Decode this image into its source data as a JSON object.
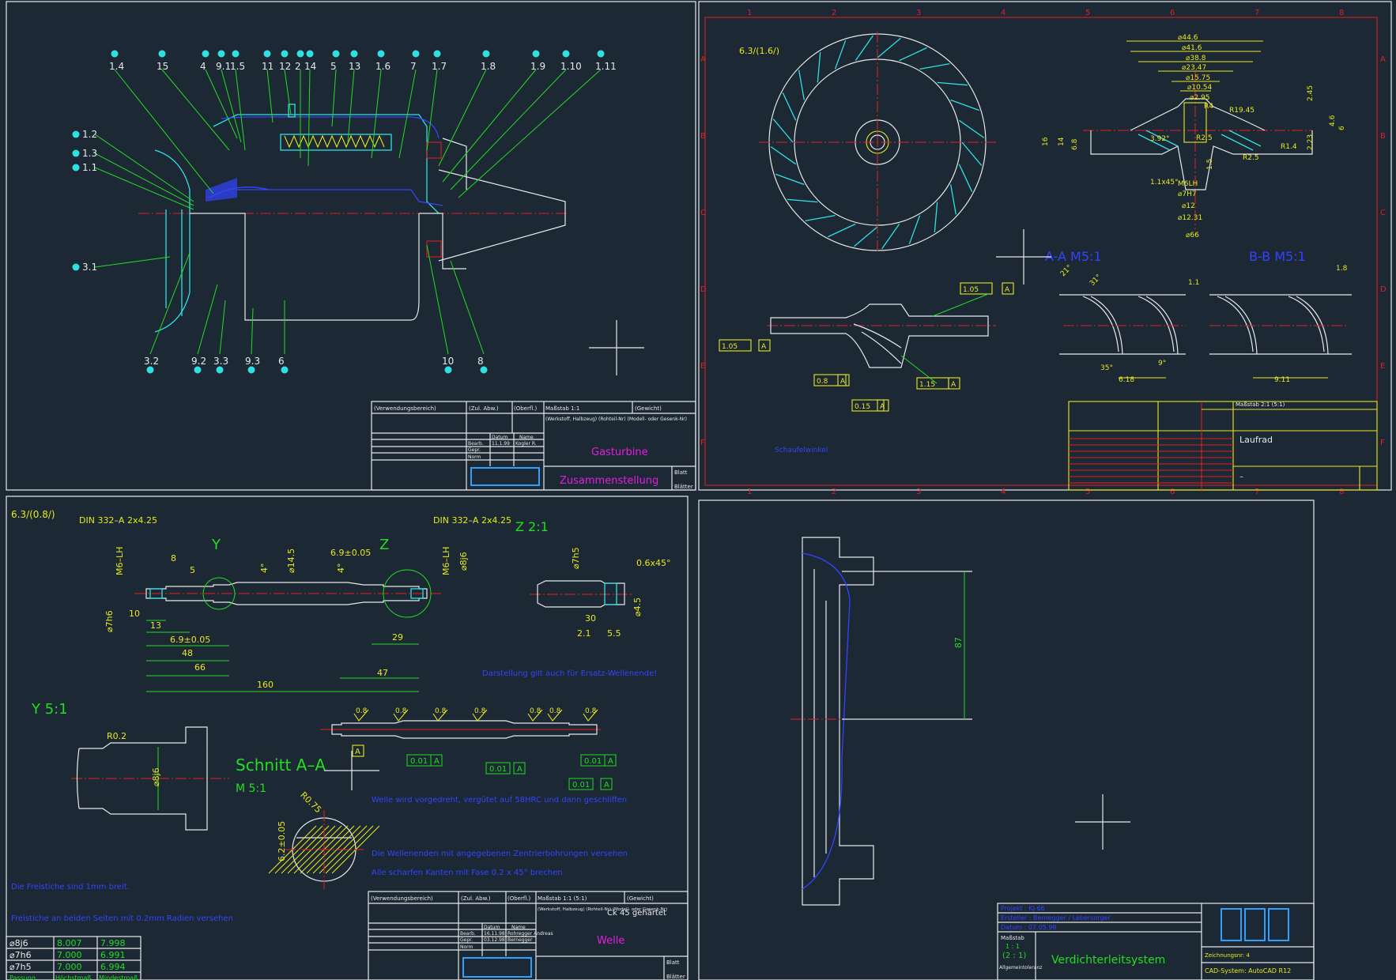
{
  "panels": {
    "gasturbine": {
      "balloons_top": [
        "1.4",
        "15",
        "4",
        "9.1",
        "1.5",
        "11",
        "12",
        "2",
        "14",
        "5",
        "13",
        "1.6",
        "7",
        "1.7",
        "1.8",
        "1.9",
        "1.10",
        "1.11"
      ],
      "balloons_left": [
        "1.2",
        "1.3",
        "1.1",
        "3.1"
      ],
      "balloons_bottom": [
        "3.2",
        "9.2",
        "3.3",
        "9.3",
        "6",
        "10",
        "8"
      ],
      "title_block": {
        "verwendung": "(Verwendungsbereich)",
        "zul_abw": "(Zul. Abw.)",
        "oberfl": "(Oberfl.)",
        "massstab": "Maßstab 1:1",
        "gewicht": "(Gewicht)",
        "werkstoff": "(Werkstoff, Halbzeug) (Rohteil-Nr) (Modell- oder Gesenk-Nr)",
        "datum_hdr": "Datum",
        "name_hdr": "Name",
        "bearb": "Bearb.",
        "bearb_date": "11.1.99",
        "bearb_name": "Kogler R.",
        "gepr": "Gepr.",
        "norm": "Norm",
        "title1": "Gasturbine",
        "title2": "Zusammenstellung",
        "blatt": "Blatt",
        "blaetter": "Blätter"
      }
    },
    "laufrad": {
      "surface": "6.3/(1.6/)",
      "dims_top": [
        "⌀44.6",
        "⌀41.6",
        "⌀38.8",
        "⌀23.47",
        "⌀15.75",
        "⌀10.54",
        "⌀2.95",
        "R4",
        "R19.45",
        "2.45",
        "4.6",
        "6"
      ],
      "dims_mid": [
        "16",
        "14",
        "6.8",
        "3.92°",
        "R2.5",
        "R1.4",
        "R2.5",
        "2.23",
        "1.5",
        "M6LH",
        "⌀7H7",
        "⌀12",
        "⌀12.31",
        "⌀66",
        "1.1x45°"
      ],
      "section_labels": [
        "A-A M5:1",
        "B-B M5:1"
      ],
      "tolerances": [
        "1.05",
        "A",
        "1.05",
        "A",
        "0.8",
        "A",
        "0.15",
        "A",
        "1.15",
        "A"
      ],
      "blade_dims": [
        "21°",
        "31°",
        "1.1",
        "1.8",
        "35°",
        "9°",
        "6.18",
        "9.11"
      ],
      "note": "Schaufelwinkel",
      "grid_cols": [
        "1",
        "2",
        "3",
        "4",
        "5",
        "6",
        "7",
        "8"
      ],
      "grid_rows": [
        "A",
        "B",
        "C",
        "D",
        "E",
        "F"
      ],
      "title_block": {
        "massstab": "Maßstab 2:1 (5:1)",
        "name": "Laufrad",
        "dash": "–"
      }
    },
    "welle": {
      "surface": "6.3/(0.8/)",
      "din_left": "DIN 332–A 2x4.25",
      "din_right": "DIN 332–A 2x4.25",
      "z_label": "Z 2:1",
      "y_label": "Y 5:1",
      "detail_y": "Y",
      "detail_z": "Z",
      "dims": [
        "8",
        "5",
        "4°",
        "⌀14.5",
        "6.9±0.05",
        "4°",
        "M6–LH",
        "⌀8j6",
        "M6–LH",
        "⌀7h6",
        "10",
        "13",
        "6.9±0.05",
        "48",
        "66",
        "160",
        "47",
        "29"
      ],
      "z_dims": [
        "⌀7h5",
        "0.6x45°",
        "30",
        "⌀4.5",
        "2.1",
        "5.5"
      ],
      "y_dims": [
        "R0.2",
        "⌀8j6"
      ],
      "section": "Schnitt A–A",
      "section_scale": "M 5:1",
      "section_dims": [
        "R0.75",
        "6.2±0.05"
      ],
      "roughness": [
        "0.8",
        "0.8",
        "0.8",
        "0.8",
        "0.8",
        "0.8",
        "0.8"
      ],
      "runouts": [
        "0.01",
        "A",
        "0.01",
        "A",
        "0.01",
        "A",
        "0.01",
        "A"
      ],
      "notes": [
        "Darstellung gilt auch für Ersatz-Wellenende!",
        "Welle wird vorgedreht, vergütet auf 58HRC und dann geschliffen",
        "Die Wellenenden mit angegebenen Zentrierbohrungen versehen",
        "Alle scharfen Kanten mit Fase 0.2 x 45° brechen",
        "Die Freistiche sind 1mm breit.",
        "Freistiche an beiden Seiten mit 0.2mm Radien versehen"
      ],
      "fit_table": {
        "rows": [
          [
            "⌀8j6",
            "8.007",
            "7.998"
          ],
          [
            "⌀7h6",
            "7.000",
            "6.991"
          ],
          [
            "⌀7h5",
            "7.000",
            "6.994"
          ]
        ],
        "footer": [
          "Passung",
          "Höchstmaß",
          "Mindestmaß"
        ]
      },
      "title_block": {
        "verwendung": "(Verwendungsbereich)",
        "zul_abw": "(Zul. Abw.)",
        "oberfl": "(Oberfl.)",
        "massstab": "Maßstab 1:1 (5:1)",
        "gewicht": "(Gewicht)",
        "werkstoff": "(Werkstoff, Halbzeug) (Rohteil-Nr) (Modell- oder Gesenk-Nr)",
        "material": "Ck 45 gehärtet",
        "datum_hdr": "Datum",
        "name_hdr": "Name",
        "bearb": "Bearb.",
        "bearb_date": "16.11.98",
        "bearb_name": "Rohregger Andreas",
        "gepr": "Gepr.",
        "gepr_date": "03.12.98",
        "gepr_name": "Bernegger",
        "norm": "Norm",
        "title": "Welle",
        "blatt": "Blatt",
        "blaetter": "Blätter"
      }
    },
    "verdichter": {
      "dim": "87",
      "title_block": {
        "projekt": "Projekt  : KJ-66",
        "ersteller": "Ersteller : Bernegger / Lebersorger",
        "datum": "Datum     : 07.05.98",
        "massstab": "Maßstab",
        "scale": "1 : 1",
        "scale2": "(2 : 1)",
        "tol": "Allgemeintoleranz",
        "title": "Verdichterleitsystem",
        "zeichnungsnr": "Zeichnungsnr: 4",
        "cad": "CAD-System: AutoCAD R12"
      }
    }
  }
}
